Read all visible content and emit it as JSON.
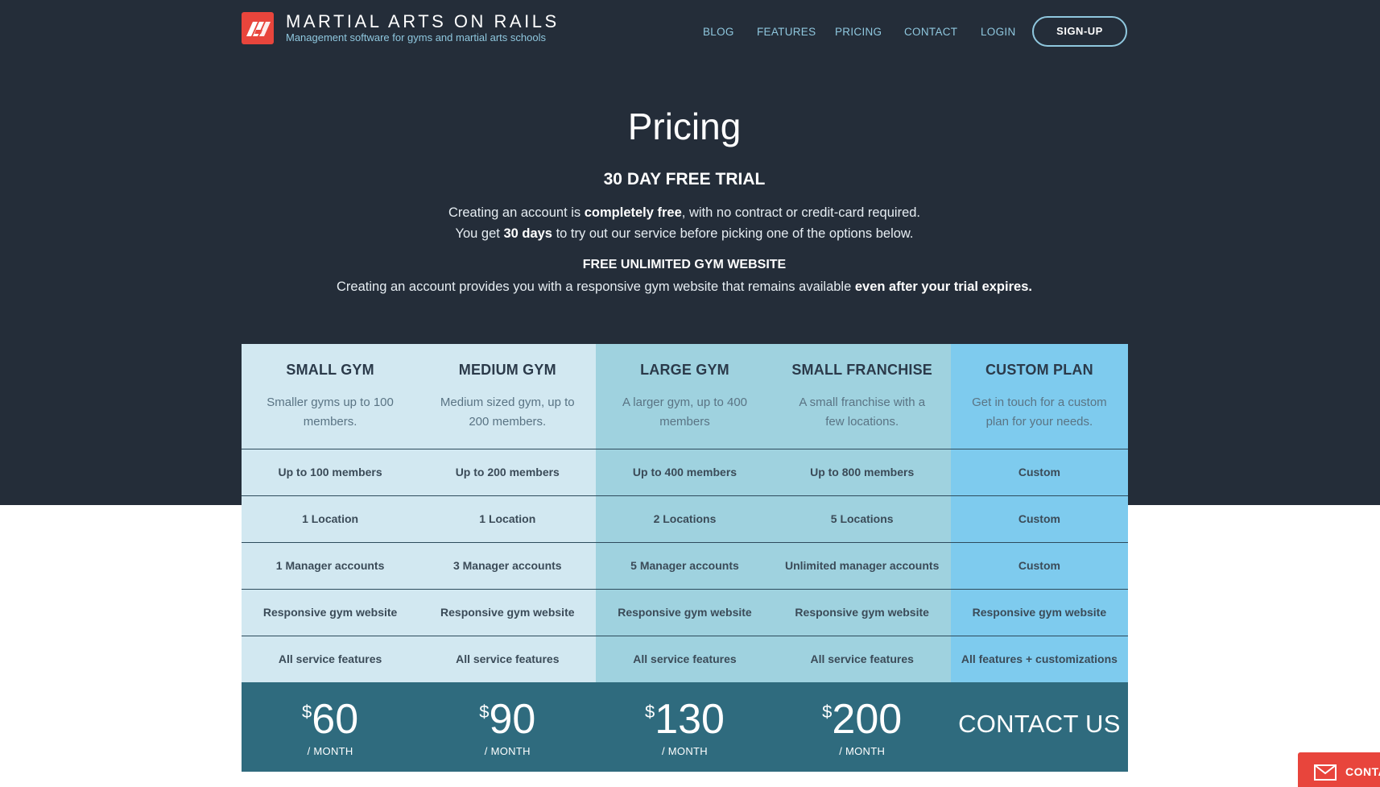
{
  "header": {
    "brand_title": "MARTIAL ARTS ON RAILS",
    "brand_subtitle": "Management software for gyms and martial arts schools",
    "nav": [
      "BLOG",
      "FEATURES",
      "PRICING",
      "CONTACT",
      "LOGIN"
    ],
    "signup_label": "SIGN-UP",
    "logo_icon": "mr-logo-icon"
  },
  "intro": {
    "title": "Pricing",
    "trial_heading": "30 DAY FREE TRIAL",
    "line1": {
      "a": "Creating an account is ",
      "b": "completely free",
      "c": ", with no contract or credit-card required."
    },
    "line2": {
      "a": "You get ",
      "b": "30 days",
      "c": " to try out our service before picking one of the options below."
    },
    "website_heading": "FREE UNLIMITED GYM WEBSITE",
    "line3": {
      "a": "Creating an account provides you with a responsive gym website that remains available ",
      "b": "even after your trial expires."
    }
  },
  "plans": [
    {
      "name": "SMALL GYM",
      "desc": "Smaller gyms up to 100 members.",
      "features": [
        "Up to 100 members",
        "1 Location",
        "1 Manager accounts",
        "Responsive gym website",
        "All service features"
      ],
      "currency": "$",
      "price": "60",
      "period": "/ MONTH",
      "contact": ""
    },
    {
      "name": "MEDIUM GYM",
      "desc": "Medium sized gym, up to 200 members.",
      "features": [
        "Up to 200 members",
        "1 Location",
        "3 Manager accounts",
        "Responsive gym website",
        "All service features"
      ],
      "currency": "$",
      "price": "90",
      "period": "/ MONTH",
      "contact": ""
    },
    {
      "name": "LARGE GYM",
      "desc": "A larger gym, up to 400 members",
      "features": [
        "Up to 400 members",
        "2 Locations",
        "5 Manager accounts",
        "Responsive gym website",
        "All service features"
      ],
      "currency": "$",
      "price": "130",
      "period": "/ MONTH",
      "contact": ""
    },
    {
      "name": "SMALL FRANCHISE",
      "desc": "A small franchise with a few locations.",
      "features": [
        "Up to 800 members",
        "5 Locations",
        "Unlimited manager accounts",
        "Responsive gym website",
        "All service features"
      ],
      "currency": "$",
      "price": "200",
      "period": "/ MONTH",
      "contact": ""
    },
    {
      "name": "CUSTOM PLAN",
      "desc": "Get in touch for a custom plan for your needs.",
      "features": [
        "Custom",
        "Custom",
        "Custom",
        "Responsive gym website",
        "All features + customizations"
      ],
      "currency": "",
      "price": "",
      "period": "",
      "contact": "CONTACT US"
    }
  ],
  "colors": {
    "hero_bg": "#242d39",
    "col_light": "#d2e8f1",
    "col_mid": "#9fd2df",
    "col_custom": "#7ecbee",
    "price_row": "#2f6b7e",
    "accent_red": "#e8453c"
  },
  "contact_tab": {
    "label": "CONTACT",
    "icon": "mail-icon"
  }
}
